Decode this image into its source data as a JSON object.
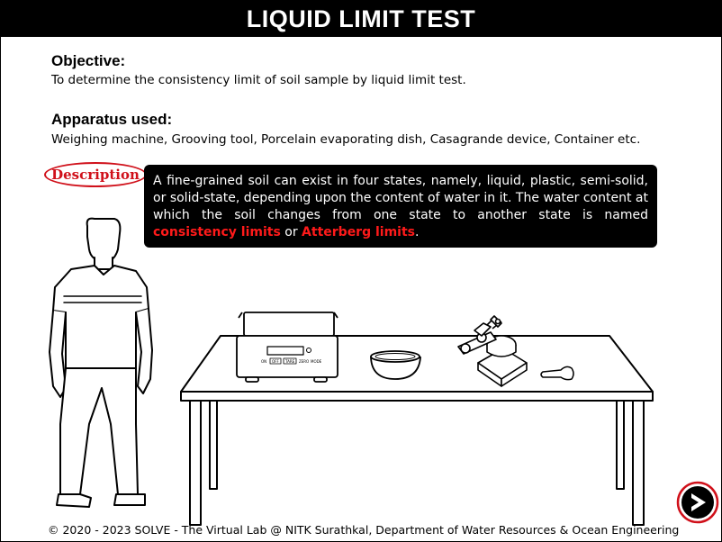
{
  "title": "LIQUID LIMIT TEST",
  "objective": {
    "heading": "Objective:",
    "text": "To determine the consistency limit of soil sample by liquid limit test."
  },
  "apparatus": {
    "heading": "Apparatus used:",
    "text": "Weighing machine, Grooving tool, Porcelain evaporating dish, Casagrande device, Container etc."
  },
  "description": {
    "button_label": "Description",
    "text_before": "A fine-grained soil can exist in four states, namely, liquid, plastic, semi-solid, or solid-state, depending upon the content of water in it. The water content at which the soil changes from one state to another state is named ",
    "highlight_1": "consistency limits",
    "connector": " or ",
    "highlight_2": "Atterberg limits",
    "text_after": "."
  },
  "scale": {
    "display": "",
    "buttons": [
      "ON",
      "OFF",
      "TARE",
      "ZERO",
      "MODE"
    ]
  },
  "footer": "© 2020 - 2023 SOLVE - The Virtual Lab @ NITK Surathkal, Department of Water Resources & Ocean Engineering",
  "colors": {
    "accent_red": "#d0101a",
    "title_bg": "#000000",
    "highlight": "#ff1a1a"
  },
  "icons": {
    "next": "play-arrow-icon"
  }
}
